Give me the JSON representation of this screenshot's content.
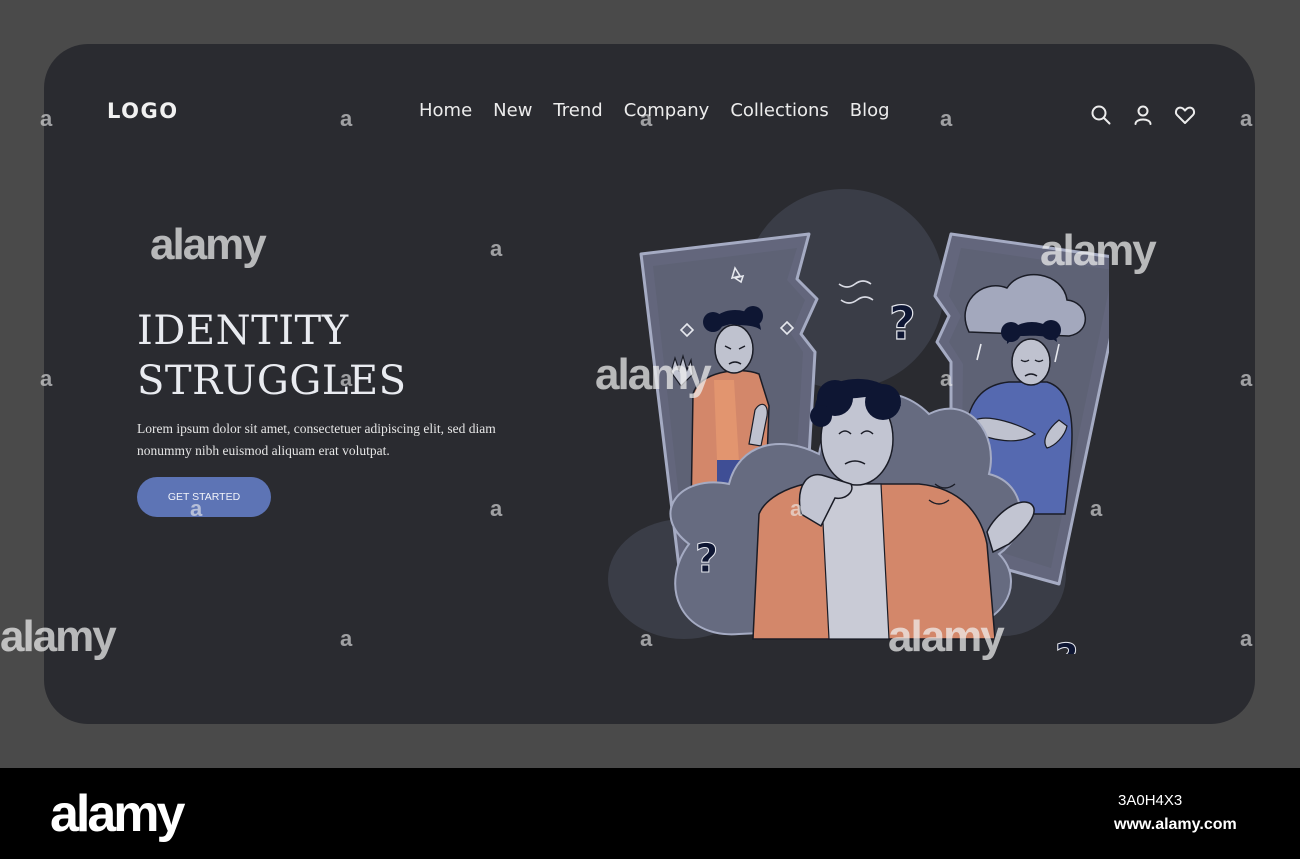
{
  "header": {
    "logo": "LOGO",
    "nav": [
      "Home",
      "New",
      "Trend",
      "Company",
      "Collections",
      "Blog"
    ],
    "icons": [
      "search-icon",
      "user-icon",
      "heart-icon"
    ]
  },
  "hero": {
    "title_line1": "IDENTITY",
    "title_line2": "STRUGGLES",
    "description": "Lorem ipsum dolor sit amet, consectetuer adipiscing elit, sed diam nonummy nibh euismod aliquam erat volutpat.",
    "cta_label": "GET STARTED"
  },
  "illustration": {
    "question_mark": "?"
  },
  "watermark": {
    "text": "alamy",
    "small_mark": "a"
  },
  "footer": {
    "brand": "alamy",
    "image_id": "3A0H4X3",
    "url": "www.alamy.com"
  },
  "colors": {
    "background": "#4a4a4a",
    "card": "#2a2b30",
    "accent": "#5d74b5",
    "jacket": "#d3876a",
    "sweater": "#5569b0",
    "hair": "#0e1633"
  }
}
